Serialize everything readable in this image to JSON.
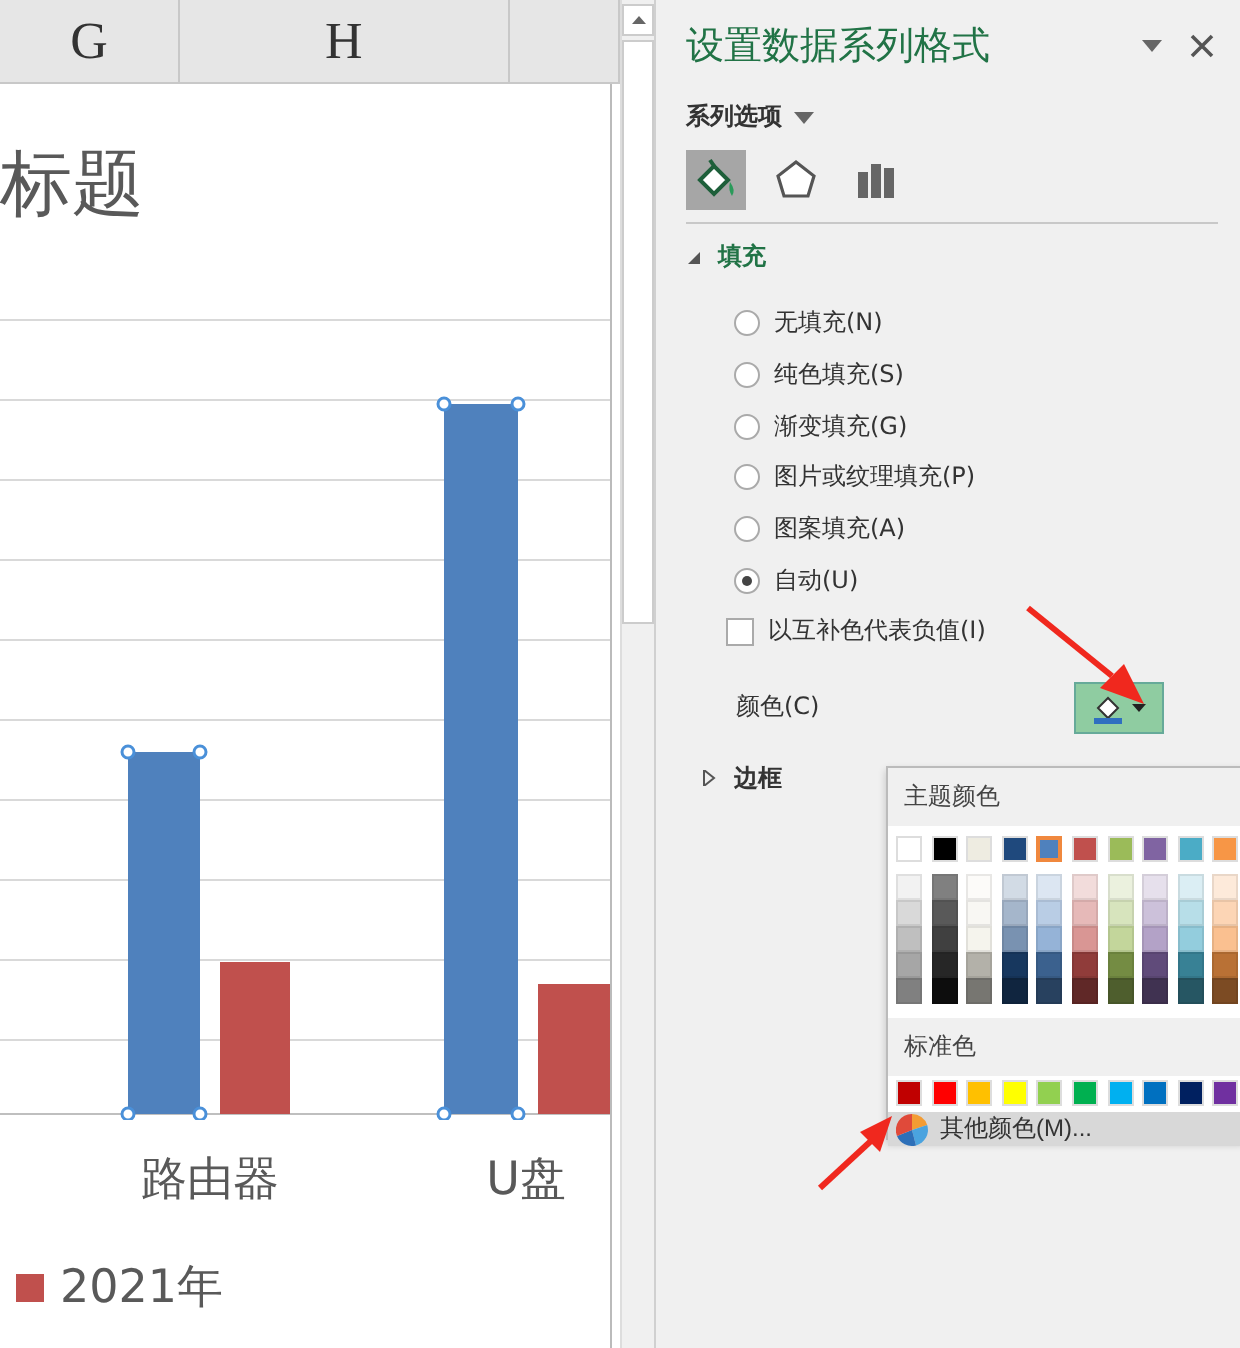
{
  "spreadsheet": {
    "column_headers": [
      "G",
      "H"
    ]
  },
  "chart": {
    "title": "标题",
    "categories": [
      "路由器",
      "U盘"
    ],
    "legend": [
      {
        "label": "2021年",
        "color": "#c0504d"
      }
    ]
  },
  "pane": {
    "title": "设置数据系列格式",
    "options_menu": "系列选项",
    "icon_tabs": [
      {
        "kind": "fill",
        "selected": true
      },
      {
        "kind": "effects",
        "selected": false
      },
      {
        "kind": "series",
        "selected": false
      }
    ],
    "fill_section": {
      "title": "填充",
      "expanded": true
    },
    "fill_options": [
      {
        "label": "无填充(N)",
        "selected": false
      },
      {
        "label": "纯色填充(S)",
        "selected": false
      },
      {
        "label": "渐变填充(G)",
        "selected": false
      },
      {
        "label": "图片或纹理填充(P)",
        "selected": false
      },
      {
        "label": "图案填充(A)",
        "selected": false
      },
      {
        "label": "自动(U)",
        "selected": true
      }
    ],
    "invert_checkbox": {
      "label": "以互补色代表负值(I)",
      "checked": false
    },
    "color_label": "颜色(C)",
    "border_section": {
      "title": "边框",
      "expanded": false
    },
    "color_picker": {
      "theme_heading": "主题颜色",
      "theme_colors": [
        {
          "color": "#ffffff",
          "selected": false
        },
        {
          "color": "#000000",
          "selected": false
        },
        {
          "color": "#eeece1",
          "selected": false
        },
        {
          "color": "#1f497d",
          "selected": false
        },
        {
          "color": "#4f81bd",
          "selected": true
        },
        {
          "color": "#c0504d",
          "selected": false
        },
        {
          "color": "#9bbb59",
          "selected": false
        },
        {
          "color": "#8064a2",
          "selected": false
        },
        {
          "color": "#4bacc6",
          "selected": false
        },
        {
          "color": "#f79646",
          "selected": false
        }
      ],
      "standard_heading": "标准色",
      "standard_colors": [
        {
          "color": "#c00000"
        },
        {
          "color": "#ff0000"
        },
        {
          "color": "#ffc000"
        },
        {
          "color": "#ffff00"
        },
        {
          "color": "#92d050"
        },
        {
          "color": "#00b050"
        },
        {
          "color": "#00b0f0"
        },
        {
          "color": "#0070c0"
        },
        {
          "color": "#002060"
        },
        {
          "color": "#7030a0"
        }
      ],
      "more_colors": "其他颜色(M)..."
    }
  }
}
